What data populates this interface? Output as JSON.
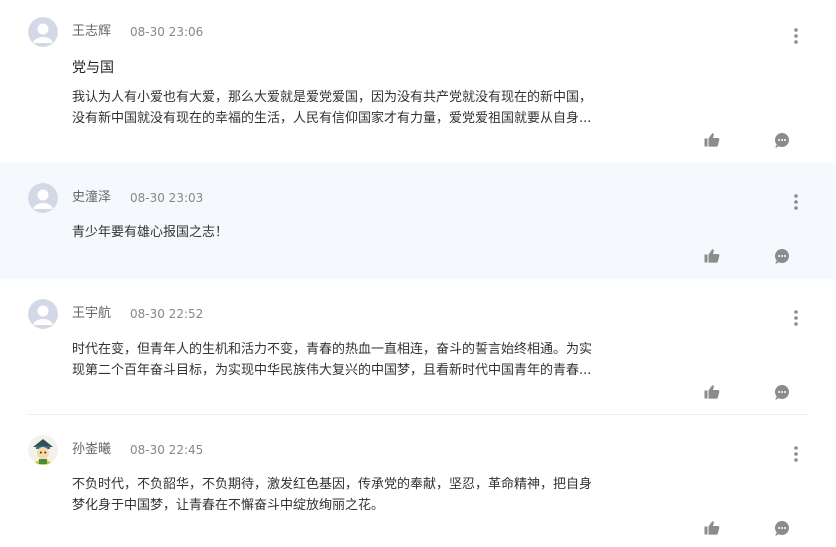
{
  "comments": [
    {
      "author": "王志辉",
      "time": "08-30 23:06",
      "title": "党与国",
      "lines": [
        "我认为人有小爱也有大爱，那么大爱就是爱党爱国，因为没有共产党就没有现在的新中国，",
        "没有新中国就没有现在的幸福的生活，人民有信仰国家才有力量，爱党爱祖国就要从自身..."
      ],
      "avatar_icon": "default-avatar-icon"
    },
    {
      "author": "史潼泽",
      "time": "08-30 23:03",
      "lines": [
        "青少年要有雄心报国之志！"
      ],
      "avatar_icon": "default-avatar-icon"
    },
    {
      "author": "王宇航",
      "time": "08-30 22:52",
      "lines": [
        "时代在变，但青年人的生机和活力不变，青春的热血一直相连，奋斗的誓言始终相通。为实",
        "现第二个百年奋斗目标，为实现中华民族伟大复兴的中国梦，且看新时代中国青年的青春..."
      ],
      "avatar_icon": "default-avatar-icon"
    },
    {
      "author": "孙崟曦",
      "time": "08-30 22:45",
      "lines": [
        "不负时代，不负韶华，不负期待，激发红色基因，传承党的奉献，坚忍，革命精神，把自身",
        "梦化身于中国梦，让青春在不懈奋斗中绽放绚丽之花。"
      ],
      "avatar_icon": "cartoon-avatar-icon"
    }
  ],
  "icons": {
    "like": "thumbs-up-icon",
    "reply": "comment-bubble-icon",
    "more": "more-vertical-icon"
  },
  "colors": {
    "highlight_bg": "#f5f8fc",
    "icon": "#8c8c8c",
    "avatar_default": "#d0d5e2"
  }
}
